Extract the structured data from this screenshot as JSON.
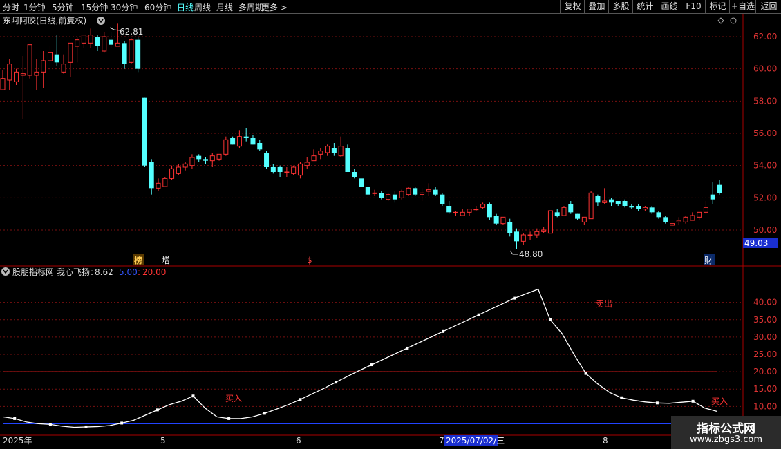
{
  "toolbar": {
    "periods": [
      "分时",
      "1分钟",
      "5分钟",
      "15分钟",
      "30分钟",
      "60分钟",
      "日线",
      "周线",
      "月线",
      "多周期",
      "更多 >"
    ],
    "active_period": "日线",
    "right_buttons": [
      "复权",
      "叠加",
      "多股",
      "统计",
      "画线",
      "F10",
      "标记",
      "+自选",
      "返回"
    ]
  },
  "main_chart": {
    "title": "东阿阿胶(日线,前复权)",
    "y_ticks": [
      "62.00",
      "60.00",
      "58.00",
      "56.00",
      "54.00",
      "52.00",
      "50.00"
    ],
    "current_price": "49.03",
    "high_label": "62.81",
    "low_label": "48.80",
    "markers": [
      "榜",
      "增",
      "$",
      "财"
    ]
  },
  "indicator": {
    "title": "股朋指标网",
    "name": "我心飞扬",
    "value": "8.62",
    "param1": "5.00",
    "param2": "20.00",
    "y_ticks": [
      "40.00",
      "35.00",
      "30.00",
      "25.00",
      "20.00",
      "15.00",
      "10.00"
    ],
    "signals": [
      "买入",
      "卖出",
      "买入"
    ]
  },
  "x_axis": {
    "labels": [
      "2025年",
      "5",
      "6",
      "7",
      "8"
    ],
    "cursor_date": "2025/07/02/三"
  },
  "watermark": {
    "title": "指标公式网",
    "url": "www.zbgs3.com"
  },
  "chart_data": {
    "type": "candlestick",
    "candles": [
      {
        "o": 58.7,
        "h": 59.9,
        "l": 58.7,
        "c": 59.4
      },
      {
        "o": 59.3,
        "h": 60.6,
        "l": 58.7,
        "c": 60.3
      },
      {
        "o": 59.2,
        "h": 60.0,
        "l": 59.0,
        "c": 59.8
      },
      {
        "o": 59.6,
        "h": 60.8,
        "l": 56.9,
        "c": 59.7
      },
      {
        "o": 59.6,
        "h": 61.5,
        "l": 59.4,
        "c": 61.5
      },
      {
        "o": 59.6,
        "h": 60.6,
        "l": 58.7,
        "c": 59.8
      },
      {
        "o": 59.8,
        "h": 61.1,
        "l": 58.8,
        "c": 60.5
      },
      {
        "o": 60.5,
        "h": 61.4,
        "l": 59.8,
        "c": 61.0
      },
      {
        "o": 60.9,
        "h": 62.1,
        "l": 60.2,
        "c": 60.4
      },
      {
        "o": 59.8,
        "h": 60.9,
        "l": 59.7,
        "c": 60.3
      },
      {
        "o": 60.4,
        "h": 61.6,
        "l": 59.5,
        "c": 61.6
      },
      {
        "o": 61.4,
        "h": 62.0,
        "l": 60.4,
        "c": 61.8
      },
      {
        "o": 61.6,
        "h": 62.1,
        "l": 61.3,
        "c": 62.1
      },
      {
        "o": 61.6,
        "h": 62.5,
        "l": 61.3,
        "c": 62.1
      },
      {
        "o": 62.0,
        "h": 62.1,
        "l": 61.1,
        "c": 61.4
      },
      {
        "o": 61.1,
        "h": 62.3,
        "l": 61.0,
        "c": 62.0
      },
      {
        "o": 61.8,
        "h": 62.3,
        "l": 61.3,
        "c": 61.5
      },
      {
        "o": 61.4,
        "h": 62.8,
        "l": 61.4,
        "c": 61.6
      },
      {
        "o": 61.6,
        "h": 61.7,
        "l": 60.0,
        "c": 60.3
      },
      {
        "o": 60.4,
        "h": 61.9,
        "l": 60.3,
        "c": 61.8
      },
      {
        "o": 61.8,
        "h": 62.0,
        "l": 59.8,
        "c": 60.0
      },
      {
        "o": 58.2,
        "h": 58.2,
        "l": 53.9,
        "c": 54.0
      },
      {
        "o": 54.2,
        "h": 54.4,
        "l": 52.2,
        "c": 52.6
      },
      {
        "o": 52.6,
        "h": 53.2,
        "l": 52.4,
        "c": 52.9
      },
      {
        "o": 52.7,
        "h": 53.3,
        "l": 52.7,
        "c": 53.2
      },
      {
        "o": 53.2,
        "h": 54.0,
        "l": 53.1,
        "c": 53.8
      },
      {
        "o": 53.5,
        "h": 54.1,
        "l": 53.4,
        "c": 53.9
      },
      {
        "o": 53.9,
        "h": 54.2,
        "l": 53.7,
        "c": 54.1
      },
      {
        "o": 54.0,
        "h": 54.7,
        "l": 53.8,
        "c": 54.5
      },
      {
        "o": 54.6,
        "h": 54.7,
        "l": 54.2,
        "c": 54.4
      },
      {
        "o": 54.4,
        "h": 54.5,
        "l": 54.1,
        "c": 54.3
      },
      {
        "o": 54.3,
        "h": 54.8,
        "l": 53.9,
        "c": 54.6
      },
      {
        "o": 54.4,
        "h": 54.7,
        "l": 54.3,
        "c": 54.7
      },
      {
        "o": 54.7,
        "h": 55.8,
        "l": 54.6,
        "c": 55.6
      },
      {
        "o": 55.7,
        "h": 55.8,
        "l": 55.3,
        "c": 55.3
      },
      {
        "o": 55.2,
        "h": 56.2,
        "l": 55.1,
        "c": 55.8
      },
      {
        "o": 55.8,
        "h": 56.3,
        "l": 55.5,
        "c": 55.7
      },
      {
        "o": 55.7,
        "h": 55.9,
        "l": 55.3,
        "c": 55.3
      },
      {
        "o": 55.4,
        "h": 55.6,
        "l": 54.9,
        "c": 55.0
      },
      {
        "o": 54.8,
        "h": 54.9,
        "l": 53.8,
        "c": 53.9
      },
      {
        "o": 53.9,
        "h": 54.1,
        "l": 53.5,
        "c": 53.6
      },
      {
        "o": 53.9,
        "h": 54.0,
        "l": 53.3,
        "c": 53.6
      },
      {
        "o": 53.6,
        "h": 53.9,
        "l": 53.3,
        "c": 53.6
      },
      {
        "o": 53.5,
        "h": 54.0,
        "l": 53.4,
        "c": 53.9
      },
      {
        "o": 53.4,
        "h": 54.2,
        "l": 53.2,
        "c": 54.1
      },
      {
        "o": 54.0,
        "h": 54.5,
        "l": 53.8,
        "c": 54.2
      },
      {
        "o": 54.3,
        "h": 55.0,
        "l": 54.3,
        "c": 54.6
      },
      {
        "o": 54.7,
        "h": 55.1,
        "l": 54.4,
        "c": 54.9
      },
      {
        "o": 54.8,
        "h": 55.3,
        "l": 54.6,
        "c": 55.2
      },
      {
        "o": 55.1,
        "h": 55.4,
        "l": 54.6,
        "c": 54.8
      },
      {
        "o": 54.6,
        "h": 55.8,
        "l": 54.5,
        "c": 55.2
      },
      {
        "o": 55.1,
        "h": 55.3,
        "l": 53.6,
        "c": 53.6
      },
      {
        "o": 53.6,
        "h": 53.8,
        "l": 53.2,
        "c": 53.3
      },
      {
        "o": 53.2,
        "h": 53.3,
        "l": 52.6,
        "c": 52.7
      },
      {
        "o": 52.7,
        "h": 52.7,
        "l": 52.2,
        "c": 52.2
      },
      {
        "o": 52.3,
        "h": 52.5,
        "l": 52.1,
        "c": 52.3
      },
      {
        "o": 52.3,
        "h": 52.4,
        "l": 51.9,
        "c": 52.0
      },
      {
        "o": 51.9,
        "h": 52.3,
        "l": 51.8,
        "c": 52.2
      },
      {
        "o": 52.2,
        "h": 52.4,
        "l": 51.7,
        "c": 51.9
      },
      {
        "o": 52.0,
        "h": 52.5,
        "l": 51.9,
        "c": 52.4
      },
      {
        "o": 52.2,
        "h": 52.7,
        "l": 52.1,
        "c": 52.6
      },
      {
        "o": 52.6,
        "h": 52.7,
        "l": 52.1,
        "c": 52.2
      },
      {
        "o": 52.2,
        "h": 52.6,
        "l": 51.8,
        "c": 52.3
      },
      {
        "o": 52.4,
        "h": 52.9,
        "l": 52.1,
        "c": 52.5
      },
      {
        "o": 52.5,
        "h": 52.7,
        "l": 52.1,
        "c": 52.2
      },
      {
        "o": 52.2,
        "h": 52.3,
        "l": 51.5,
        "c": 51.6
      },
      {
        "o": 51.5,
        "h": 51.8,
        "l": 51.0,
        "c": 51.1
      },
      {
        "o": 51.1,
        "h": 51.2,
        "l": 50.9,
        "c": 51.1
      },
      {
        "o": 50.9,
        "h": 51.3,
        "l": 50.9,
        "c": 51.1
      },
      {
        "o": 51.1,
        "h": 51.3,
        "l": 50.9,
        "c": 51.3
      },
      {
        "o": 51.3,
        "h": 51.5,
        "l": 51.2,
        "c": 51.3
      },
      {
        "o": 51.4,
        "h": 51.7,
        "l": 51.3,
        "c": 51.6
      },
      {
        "o": 51.6,
        "h": 51.7,
        "l": 50.6,
        "c": 50.8
      },
      {
        "o": 50.9,
        "h": 51.0,
        "l": 50.3,
        "c": 50.4
      },
      {
        "o": 50.4,
        "h": 50.8,
        "l": 50.3,
        "c": 50.8
      },
      {
        "o": 50.5,
        "h": 50.7,
        "l": 49.6,
        "c": 49.8
      },
      {
        "o": 49.9,
        "h": 50.1,
        "l": 48.8,
        "c": 49.3
      },
      {
        "o": 49.3,
        "h": 49.8,
        "l": 49.1,
        "c": 49.7
      },
      {
        "o": 49.7,
        "h": 49.9,
        "l": 49.4,
        "c": 49.7
      },
      {
        "o": 49.7,
        "h": 50.1,
        "l": 49.5,
        "c": 49.9
      },
      {
        "o": 49.9,
        "h": 50.2,
        "l": 49.8,
        "c": 50.0
      },
      {
        "o": 49.8,
        "h": 51.2,
        "l": 49.8,
        "c": 51.2
      },
      {
        "o": 51.1,
        "h": 51.3,
        "l": 50.8,
        "c": 50.9
      },
      {
        "o": 50.9,
        "h": 51.5,
        "l": 50.9,
        "c": 51.4
      },
      {
        "o": 51.6,
        "h": 51.8,
        "l": 51.0,
        "c": 51.1
      },
      {
        "o": 51.0,
        "h": 51.0,
        "l": 50.6,
        "c": 50.7
      },
      {
        "o": 50.5,
        "h": 50.8,
        "l": 50.3,
        "c": 50.8
      },
      {
        "o": 50.7,
        "h": 52.4,
        "l": 50.7,
        "c": 52.3
      },
      {
        "o": 52.1,
        "h": 52.2,
        "l": 51.5,
        "c": 51.7
      },
      {
        "o": 51.7,
        "h": 52.6,
        "l": 51.6,
        "c": 51.8
      },
      {
        "o": 51.9,
        "h": 52.0,
        "l": 51.5,
        "c": 51.7
      },
      {
        "o": 51.8,
        "h": 51.8,
        "l": 51.5,
        "c": 51.6
      },
      {
        "o": 51.8,
        "h": 51.9,
        "l": 51.4,
        "c": 51.5
      },
      {
        "o": 51.5,
        "h": 51.6,
        "l": 51.3,
        "c": 51.4
      },
      {
        "o": 51.5,
        "h": 51.6,
        "l": 51.2,
        "c": 51.3
      },
      {
        "o": 51.3,
        "h": 51.5,
        "l": 51.2,
        "c": 51.4
      },
      {
        "o": 51.4,
        "h": 51.5,
        "l": 51.0,
        "c": 51.1
      },
      {
        "o": 51.1,
        "h": 51.2,
        "l": 50.7,
        "c": 50.8
      },
      {
        "o": 50.8,
        "h": 50.9,
        "l": 50.4,
        "c": 50.5
      },
      {
        "o": 50.3,
        "h": 50.6,
        "l": 50.2,
        "c": 50.4
      },
      {
        "o": 50.5,
        "h": 50.8,
        "l": 50.3,
        "c": 50.6
      },
      {
        "o": 50.5,
        "h": 50.9,
        "l": 50.4,
        "c": 50.8
      },
      {
        "o": 50.6,
        "h": 51.1,
        "l": 50.6,
        "c": 50.9
      },
      {
        "o": 50.8,
        "h": 51.1,
        "l": 50.6,
        "c": 51.1
      },
      {
        "o": 51.1,
        "h": 51.8,
        "l": 51.0,
        "c": 51.4
      },
      {
        "o": 52.2,
        "h": 53.0,
        "l": 51.6,
        "c": 51.9
      },
      {
        "o": 52.8,
        "h": 53.1,
        "l": 52.2,
        "c": 52.3
      }
    ],
    "indicator": {
      "values": [
        7.0,
        6.5,
        5.5,
        5.0,
        4.8,
        4.3,
        4.0,
        4.1,
        4.2,
        4.5,
        5.2,
        6.0,
        7.5,
        9.0,
        10.5,
        11.5,
        13.0,
        9.5,
        7.0,
        6.5,
        6.5,
        7.0,
        8.0,
        9.2,
        10.5,
        12.0,
        13.6,
        15.2,
        17.0,
        18.7,
        20.4,
        22.0,
        23.6,
        25.2,
        26.8,
        28.4,
        30.0,
        31.6,
        33.2,
        34.8,
        36.4,
        38.0,
        39.6,
        41.2,
        42.5,
        43.8,
        35.0,
        31.0,
        25.0,
        19.5,
        16.5,
        14.0,
        12.5,
        11.8,
        11.3,
        11.0,
        10.9,
        11.2,
        11.5,
        9.5,
        8.6
      ],
      "line1": 5.0,
      "line2": 20.0,
      "signals": [
        {
          "label": "买入",
          "value": 11.0
        },
        {
          "label": "卖出",
          "value": 39.0
        },
        {
          "label": "买入",
          "value": 9.8
        }
      ]
    },
    "ylim_main": [
      48.2,
      63.2
    ],
    "ylim_indicator": [
      2.5,
      46.5
    ]
  }
}
